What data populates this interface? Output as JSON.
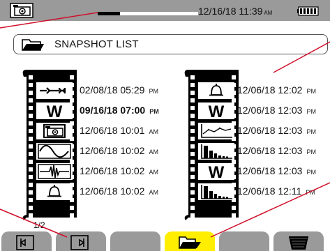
{
  "status": {
    "camera_icon": "camera-icon",
    "recording_progress_fraction": 0.22,
    "date": "12/16/18",
    "time": "11:39",
    "ampm": "AM",
    "battery_icon": "battery-full-icon"
  },
  "header": {
    "icon": "open-folder-icon",
    "title": "SNAPSHOT LIST"
  },
  "left_list": [
    {
      "icon": "wrench-icon",
      "date": "02/08/18",
      "time": "05:29",
      "ampm": "PM",
      "bold": false
    },
    {
      "icon": "power-w-icon",
      "date": "09/16/18",
      "time": "07:00",
      "ampm": "PM",
      "bold": true
    },
    {
      "icon": "camera-icon",
      "date": "12/06/18",
      "time": "10:01",
      "ampm": "AM",
      "bold": false
    },
    {
      "icon": "waveform-icon",
      "date": "12/06/18",
      "time": "10:02",
      "ampm": "AM",
      "bold": false
    },
    {
      "icon": "transient-icon",
      "date": "12/06/18",
      "time": "10:02",
      "ampm": "AM",
      "bold": false
    },
    {
      "icon": "alarm-bell-icon",
      "date": "12/06/18",
      "time": "10:02",
      "ampm": "AM",
      "bold": false
    }
  ],
  "right_list": [
    {
      "icon": "alarm-bell-icon",
      "date": "12/06/18",
      "time": "12:02",
      "ampm": "PM",
      "bold": false
    },
    {
      "icon": "power-w-icon",
      "date": "12/06/18",
      "time": "12:03",
      "ampm": "PM",
      "bold": false
    },
    {
      "icon": "trend-icon",
      "date": "12/06/18",
      "time": "12:03",
      "ampm": "PM",
      "bold": false
    },
    {
      "icon": "harmonics-icon",
      "date": "12/06/18",
      "time": "12:03",
      "ampm": "PM",
      "bold": false
    },
    {
      "icon": "power-w-icon",
      "date": "12/06/18",
      "time": "12:03",
      "ampm": "PM",
      "bold": false
    },
    {
      "icon": "harmonics-icon",
      "date": "12/06/18",
      "time": "12:11",
      "ampm": "PM",
      "bold": false
    }
  ],
  "page_indicator": "1/2",
  "softkeys": [
    {
      "name": "softkey-previous-page",
      "icon": "page-left-icon",
      "active": false
    },
    {
      "name": "softkey-next-page",
      "icon": "page-right-icon",
      "active": false
    },
    {
      "name": "softkey-blank-3",
      "icon": "",
      "active": false
    },
    {
      "name": "softkey-open",
      "icon": "open-folder-icon",
      "active": true
    },
    {
      "name": "softkey-blank-5",
      "icon": "",
      "active": false
    },
    {
      "name": "softkey-delete",
      "icon": "trash-icon",
      "active": false
    }
  ],
  "colors": {
    "bar_gray": "#9a9a9a",
    "active_key": "#ffee00",
    "callout_red": "#d0102a"
  }
}
